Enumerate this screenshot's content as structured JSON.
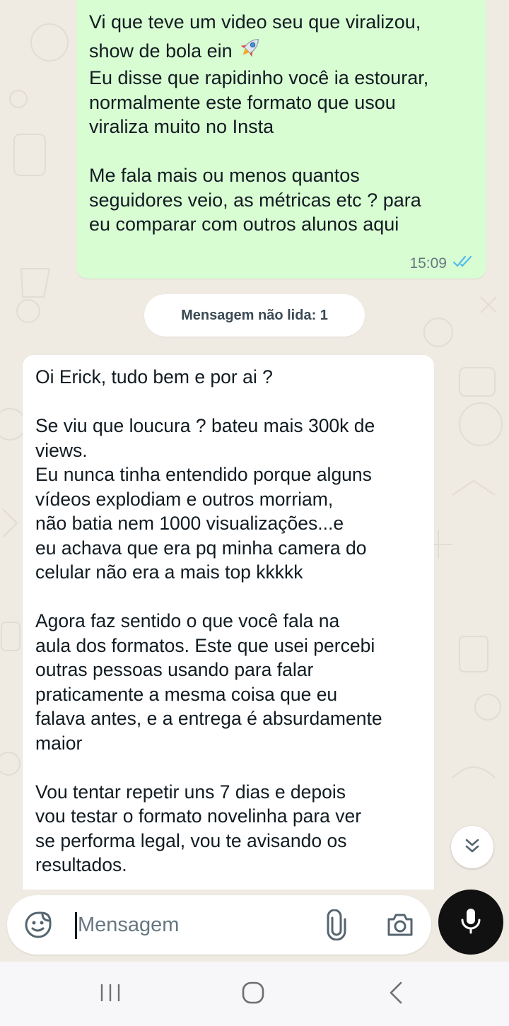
{
  "conversation": {
    "outgoing_message": {
      "lines": [
        "Vi que teve um video seu que viralizou,",
        "show de bola ein 🚀",
        "Eu disse que rapidinho você ia estourar,",
        "normalmente este formato que usou",
        "viraliza muito no Insta",
        "",
        "Me fala mais ou menos quantos",
        "seguidores veio, as métricas etc ? para",
        "eu comparar com outros alunos aqui"
      ],
      "text_main": "Vi que teve um video seu que viralizou,\nshow de bola ein ",
      "text_rest": "\nEu disse que rapidinho você ia estourar,\nnormalmente este formato que usou\nviraliza muito no Insta\n\nMe fala mais ou menos quantos\nseguidores veio, as métricas etc ? para\neu comparar com outros alunos aqui",
      "emoji": "rocket",
      "time": "15:09",
      "status": "read",
      "status_color": "#53bdeb"
    },
    "unread_divider": "Mensagem não lida: 1",
    "incoming_message": {
      "text": "Oi Erick, tudo bem e por ai ?\n\nSe viu que loucura ? bateu mais 300k de\nviews.\nEu nunca tinha entendido porque alguns\nvídeos explodiam e outros morriam,\nnão batia nem 1000 visualizações...e\neu achava que era pq minha camera do\ncelular não era a mais top kkkkk\n\nAgora faz sentido o que você fala na\naula dos formatos. Este que usei percebi\noutras pessoas usando para falar\npraticamente a mesma coisa que eu\nfalava antes, e a entrega é absurdamente\nmaior\n\nVou tentar repetir uns 7 dias e depois\nvou testar o formato novelinha para ver\nse performa legal, vou te avisando os\nresultados."
    }
  },
  "composer": {
    "placeholder": "Mensagem",
    "value": "",
    "icons": [
      "sticker-icon",
      "attach-icon",
      "camera-icon",
      "mic-icon"
    ]
  },
  "navigation": {
    "buttons": [
      "recent-apps",
      "home",
      "back"
    ]
  },
  "colors": {
    "chat_background": "#efeae2",
    "outgoing_bubble": "#d9fdd3",
    "incoming_bubble": "#ffffff",
    "read_ticks": "#53bdeb",
    "mic_button": "#111111"
  }
}
